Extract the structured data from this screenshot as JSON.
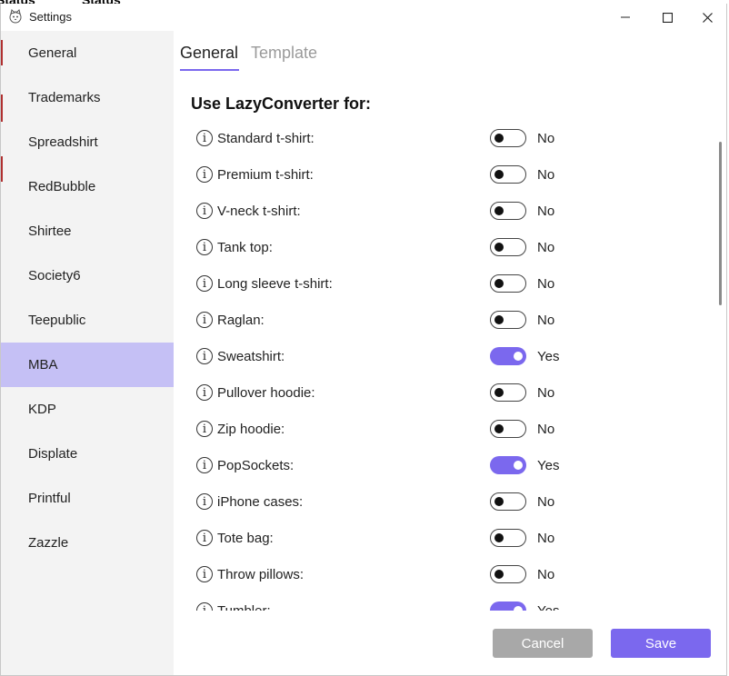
{
  "background": {
    "text_1": "Status",
    "text_2": "Status"
  },
  "window": {
    "title": "Settings"
  },
  "sidebar": {
    "items": [
      {
        "label": "General"
      },
      {
        "label": "Trademarks"
      },
      {
        "label": "Spreadshirt"
      },
      {
        "label": "RedBubble"
      },
      {
        "label": "Shirtee"
      },
      {
        "label": "Society6"
      },
      {
        "label": "Teepublic"
      },
      {
        "label": "MBA",
        "active": true
      },
      {
        "label": "KDP"
      },
      {
        "label": "Displate"
      },
      {
        "label": "Printful"
      },
      {
        "label": "Zazzle"
      }
    ]
  },
  "tabs": [
    {
      "label": "General",
      "active": true
    },
    {
      "label": "Template",
      "active": false
    }
  ],
  "section": {
    "title": "Use LazyConverter for:"
  },
  "options": [
    {
      "label": "Standard t-shirt:",
      "on": false,
      "state": "No"
    },
    {
      "label": "Premium t-shirt:",
      "on": false,
      "state": "No"
    },
    {
      "label": "V-neck t-shirt:",
      "on": false,
      "state": "No"
    },
    {
      "label": "Tank top:",
      "on": false,
      "state": "No"
    },
    {
      "label": "Long sleeve t-shirt:",
      "on": false,
      "state": "No"
    },
    {
      "label": "Raglan:",
      "on": false,
      "state": "No"
    },
    {
      "label": "Sweatshirt:",
      "on": true,
      "state": "Yes"
    },
    {
      "label": "Pullover hoodie:",
      "on": false,
      "state": "No"
    },
    {
      "label": "Zip hoodie:",
      "on": false,
      "state": "No"
    },
    {
      "label": "PopSockets:",
      "on": true,
      "state": "Yes"
    },
    {
      "label": "iPhone cases:",
      "on": false,
      "state": "No"
    },
    {
      "label": "Tote bag:",
      "on": false,
      "state": "No"
    },
    {
      "label": "Throw pillows:",
      "on": false,
      "state": "No"
    },
    {
      "label": "Tumbler:",
      "on": true,
      "state": "Yes"
    }
  ],
  "footer": {
    "cancel_label": "Cancel",
    "save_label": "Save"
  },
  "colors": {
    "accent": "#7b68ee",
    "active_nav": "#c5c0f5",
    "sidebar_bg": "#f3f3f3",
    "cancel_bg": "#a8a8a8"
  },
  "icons": {
    "app": "cat-face-icon",
    "info": "info-icon",
    "minimize": "minimize-icon",
    "maximize": "maximize-icon",
    "close": "close-icon"
  }
}
